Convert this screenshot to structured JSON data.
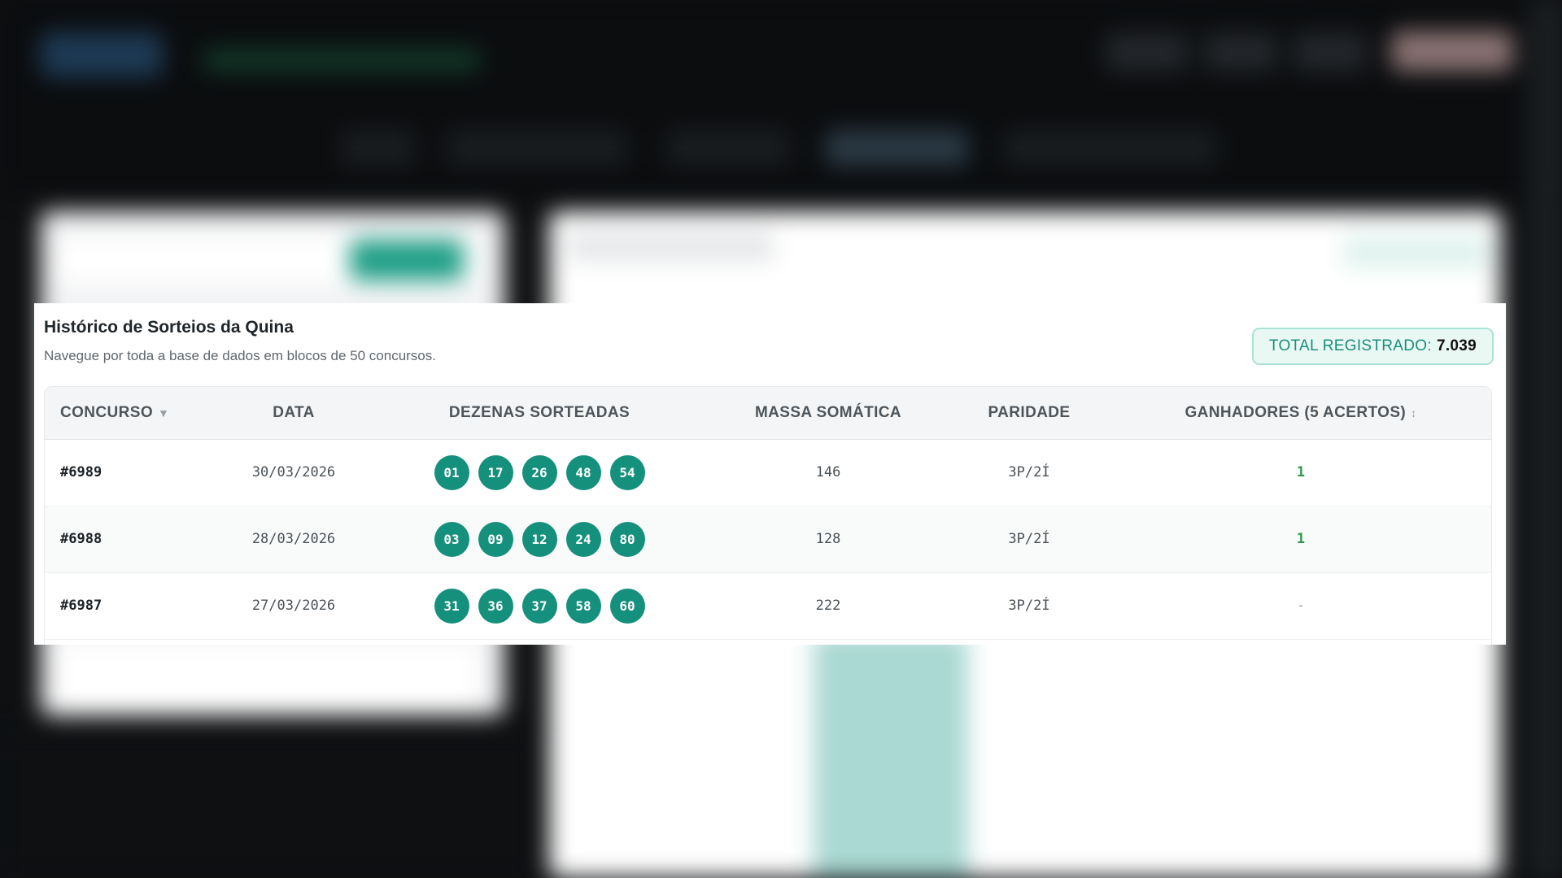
{
  "panel": {
    "title": "Histórico de Sorteios da Quina",
    "subtitle": "Navegue por toda a base de dados em blocos de 50 concursos.",
    "total_label": "TOTAL REGISTRADO:",
    "total_value": "7.039"
  },
  "table": {
    "headers": {
      "concurso": "CONCURSO",
      "data": "DATA",
      "dezenas": "DEZENAS SORTEADAS",
      "massa": "MASSA SOMÁTICA",
      "paridade": "PARIDADE",
      "ganhadores": "GANHADORES (5 ACERTOS)"
    },
    "sort_icons": {
      "concurso": "caret-down-icon",
      "ganhadores": "sort-icon"
    },
    "rows": [
      {
        "concurso": "#6989",
        "data": "30/03/2026",
        "dezenas": [
          "01",
          "17",
          "26",
          "48",
          "54"
        ],
        "massa": "146",
        "paridade": "3P/2Í",
        "ganhadores": "1"
      },
      {
        "concurso": "#6988",
        "data": "28/03/2026",
        "dezenas": [
          "03",
          "09",
          "12",
          "24",
          "80"
        ],
        "massa": "128",
        "paridade": "3P/2Í",
        "ganhadores": "1"
      },
      {
        "concurso": "#6987",
        "data": "27/03/2026",
        "dezenas": [
          "31",
          "36",
          "37",
          "58",
          "60"
        ],
        "massa": "222",
        "paridade": "3P/2Í",
        "ganhadores": "-"
      }
    ]
  },
  "colors": {
    "accent": "#15907c",
    "winner": "#2c9a4a",
    "badge_border": "#a9e3d5"
  }
}
